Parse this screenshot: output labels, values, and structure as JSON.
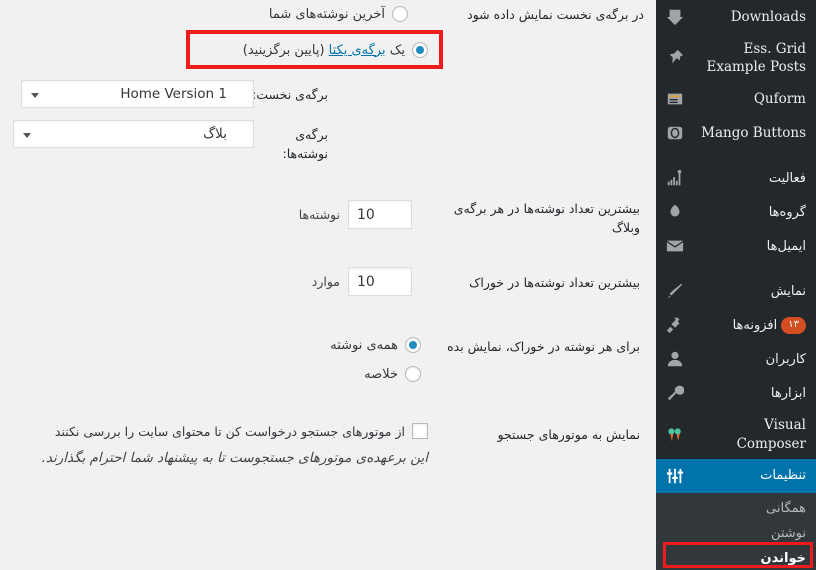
{
  "colors": {
    "sidebar_bg": "#23282d",
    "submenu_bg": "#32373c",
    "current_blue": "#0073aa",
    "badge_orange": "#d54e21",
    "radio_dot": "#1e8cbe",
    "annotation_red": "#ee1c1c",
    "page_bg": "#f1f1f1",
    "link_blue": "#0073aa"
  },
  "sidebar": {
    "items": [
      {
        "label": "Downloads",
        "icon": "download-icon",
        "latin": true,
        "current": false
      },
      {
        "label": "Ess. Grid Example Posts",
        "icon": "pin-icon",
        "latin": true,
        "current": false
      },
      {
        "label": "Quform",
        "icon": "form-icon",
        "latin": true,
        "current": false
      },
      {
        "label": "Mango Buttons",
        "icon": "button-icon",
        "latin": true,
        "current": false
      },
      {
        "separator": true
      },
      {
        "label": "فعالیت",
        "icon": "activity-icon",
        "latin": false,
        "current": false
      },
      {
        "label": "گروه‌ها",
        "icon": "groups-icon",
        "latin": false,
        "current": false
      },
      {
        "label": "ایمیل‌ها",
        "icon": "email-icon",
        "latin": false,
        "current": false
      },
      {
        "separator": true
      },
      {
        "label": "نمایش",
        "icon": "appearance-icon",
        "latin": false,
        "current": false
      },
      {
        "label": "افزونه‌ها",
        "icon": "plugins-icon",
        "latin": false,
        "current": false,
        "badge": "۱۳"
      },
      {
        "label": "کاربران",
        "icon": "users-icon",
        "latin": false,
        "current": false
      },
      {
        "label": "ابزارها",
        "icon": "tools-icon",
        "latin": false,
        "current": false
      },
      {
        "label": "Visual Composer",
        "icon": "visual-composer-icon",
        "latin": true,
        "current": false
      },
      {
        "label": "تنظیمات",
        "icon": "settings-icon",
        "latin": false,
        "current": true
      }
    ],
    "submenu": [
      {
        "label": "همگانی",
        "current": false
      },
      {
        "label": "نوشتن",
        "current": false
      },
      {
        "label": "خواندن",
        "current": true
      }
    ]
  },
  "form": {
    "front_page": {
      "label": "در برگه‌ی نخست نمایش داده شود",
      "options": [
        {
          "text": "آخرین نوشته‌های شما",
          "selected": false
        },
        {
          "text_before": "یک ",
          "link": "برگه‌ی یکتا",
          "text_after": " (پایین برگزینید)",
          "selected": true
        }
      ],
      "front_label": "برگه‌ی نخست:",
      "front_value": "Home Version 1",
      "posts_label": "برگه‌ی نوشته‌ها:",
      "posts_value": "بلاگ"
    },
    "posts_per_page": {
      "label": "بیشترین تعداد نوشته‌ها در هر برگه‌ی وبلاگ",
      "value": "10",
      "unit": "نوشته‌ها"
    },
    "posts_per_rss": {
      "label": "بیشترین تعداد نوشته‌ها در خوراک",
      "value": "10",
      "unit": "موارد"
    },
    "feed_shows": {
      "label": "برای هر نوشته در خوراک، نمایش بده",
      "options": [
        {
          "text": "همه‌ی نوشته",
          "selected": true
        },
        {
          "text": "خلاصه",
          "selected": false
        }
      ]
    },
    "search_visibility": {
      "label": "نمایش به موتورهای جستجو",
      "checkbox_label": "از موتورهای جستجو درخواست کن تا محتوای سایت را بررسی نکنند",
      "checked": false,
      "note": "این برعهده‌ی موتورهای جستجوست تا به پیشنهاد شما احترام بگذارند."
    }
  },
  "annotations": [
    {
      "name": "highlight-static-page-radio"
    },
    {
      "name": "highlight-reading-submenu"
    }
  ]
}
